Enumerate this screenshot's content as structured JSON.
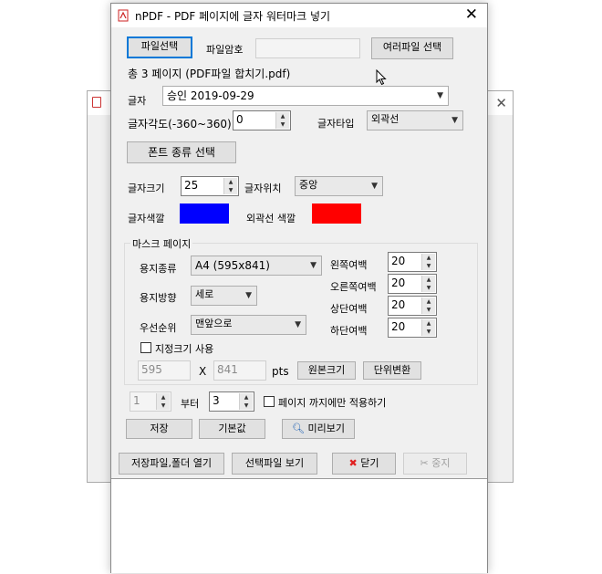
{
  "background_window": {
    "close_icon": "close-icon"
  },
  "window": {
    "title": "nPDF - PDF 페이지에 글자 워터마크 넣기",
    "close_glyph": "✕"
  },
  "file": {
    "select_button": "파일선택",
    "password_label": "파일암호",
    "password_value": "",
    "multi_select_button": "여러파일 선택",
    "info": "총 3 페이지 (PDF파일 합치기.pdf)"
  },
  "text_field": {
    "label": "글자",
    "value": "승인 2019-09-29"
  },
  "angle": {
    "label": "글자각도(-360~360)",
    "value": "0"
  },
  "text_type": {
    "label": "글자타입",
    "value": "외곽선"
  },
  "font_button": "폰트 종류 선택",
  "size": {
    "label": "글자크기",
    "value": "25"
  },
  "position": {
    "label": "글자위치",
    "value": "중앙"
  },
  "color": {
    "label": "글자색깔",
    "value": "#0000ff"
  },
  "outline_color": {
    "label": "외곽선 색깔",
    "value": "#ff0000"
  },
  "mask": {
    "legend": "마스크 페이지",
    "paper_type_label": "용지종류",
    "paper_type_value": "A4 (595x841)",
    "orientation_label": "용지방향",
    "orientation_value": "세로",
    "priority_label": "우선순위",
    "priority_value": "맨앞으로",
    "margins": [
      {
        "label": "왼쪽여백",
        "value": "20"
      },
      {
        "label": "오른쪽여백",
        "value": "20"
      },
      {
        "label": "상단여백",
        "value": "20"
      },
      {
        "label": "하단여백",
        "value": "20"
      }
    ],
    "custom_size_label": "지정크기 사용",
    "custom_width": "595",
    "x_label": "X",
    "custom_height": "841",
    "unit_label": "pts",
    "original_size_button": "원본크기",
    "unit_convert_button": "단위변환"
  },
  "range": {
    "from_value": "1",
    "from_label": "부터",
    "to_value": "3",
    "apply_label": "페이지 까지에만 적용하기"
  },
  "actions": {
    "save": "저장",
    "default": "기본값",
    "preview": "미리보기"
  },
  "bottom": {
    "open_folder": "저장파일,폴더 열기",
    "view_selected": "선택파일 보기",
    "close": "닫기",
    "stop": "중지"
  }
}
